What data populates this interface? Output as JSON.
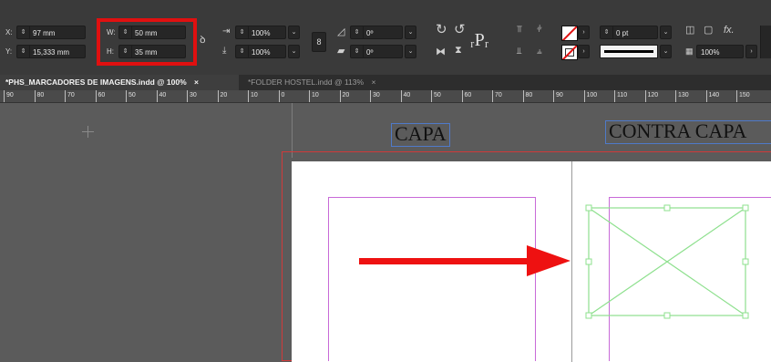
{
  "control_panel": {
    "x_label": "X:",
    "x_value": "97 mm",
    "y_label": "Y:",
    "y_value": "15,333 mm",
    "w_label": "W:",
    "w_value": "50 mm",
    "h_label": "H:",
    "h_value": "35 mm",
    "scale_x": "100%",
    "scale_y": "100%",
    "rotate": "0º",
    "shear": "0º",
    "stroke_weight": "0 pt",
    "opacity": "100%",
    "effects_label": "fx."
  },
  "tabs": [
    {
      "label": "*PHS_MARCADORES DE IMAGENS.indd @ 100%",
      "close": "×",
      "active": true
    },
    {
      "label": "*FOLDER HOSTEL.indd @ 113%",
      "close": "×",
      "active": false
    }
  ],
  "ruler_labels": [
    "90",
    "80",
    "70",
    "60",
    "50",
    "40",
    "30",
    "20",
    "10",
    "0",
    "10",
    "20",
    "30",
    "40",
    "50",
    "60",
    "70",
    "80",
    "90",
    "100",
    "110",
    "120",
    "130",
    "140",
    "150"
  ],
  "page_labels": {
    "left": "CAPA",
    "right": "CONTRA CAPA"
  },
  "highlight_color": "#e01010",
  "arrow_color": "#ee1111",
  "frame_color": "#8ee08e"
}
